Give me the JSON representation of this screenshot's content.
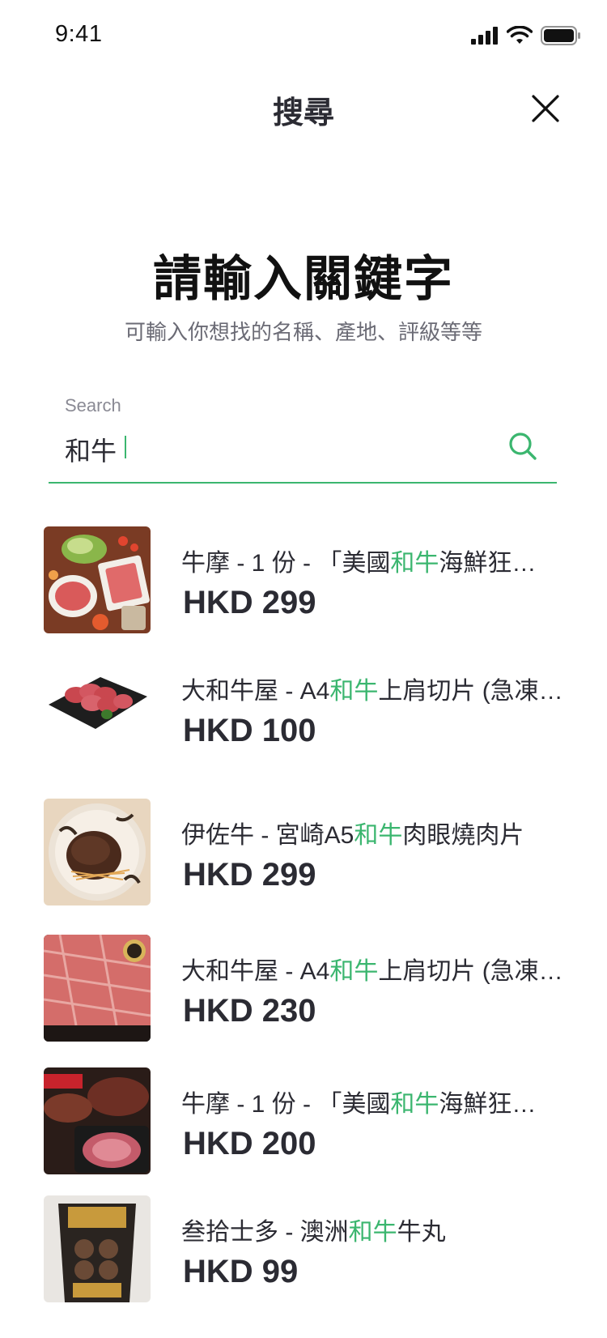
{
  "status": {
    "time": "9:41"
  },
  "nav": {
    "title": "搜尋",
    "close_icon": "close-icon"
  },
  "header": {
    "heading": "請輸入關鍵字",
    "subheading": "可輸入你想找的名稱、產地、評級等等"
  },
  "search": {
    "label": "Search",
    "value": "和牛",
    "icon": "search-icon"
  },
  "colors": {
    "accent": "#3bb66f",
    "text": "#2b2b33",
    "muted": "#6b6b75"
  },
  "results": [
    {
      "title_prefix": "牛摩 - 1 份 - 「美國",
      "title_highlight": "和牛",
      "title_suffix": "海鮮狂…",
      "price": "HKD 299",
      "image": "hotpot-platter"
    },
    {
      "title_prefix": "大和牛屋 - A4",
      "title_highlight": "和牛",
      "title_suffix": "上肩切片 (急凍…",
      "price": "HKD 100",
      "image": "beef-rolls-on-slate"
    },
    {
      "title_prefix": "伊佐牛 - 宮崎A5",
      "title_highlight": "和牛",
      "title_suffix": "肉眼燒肉片",
      "price": "HKD 299",
      "image": "hamburg-steak"
    },
    {
      "title_prefix": "大和牛屋 - A4",
      "title_highlight": "和牛",
      "title_suffix": "上肩切片 (急凍…",
      "price": "HKD 230",
      "image": "marbled-beef-slices"
    },
    {
      "title_prefix": "牛摩 - 1 份 - 「美國",
      "title_highlight": "和牛",
      "title_suffix": "海鮮狂…",
      "price": "HKD 200",
      "image": "steak-package"
    },
    {
      "title_prefix": "叁拾士多 - 澳洲",
      "title_highlight": "和牛",
      "title_suffix": "牛丸",
      "price": "HKD 99",
      "image": "beef-ball-box"
    }
  ]
}
